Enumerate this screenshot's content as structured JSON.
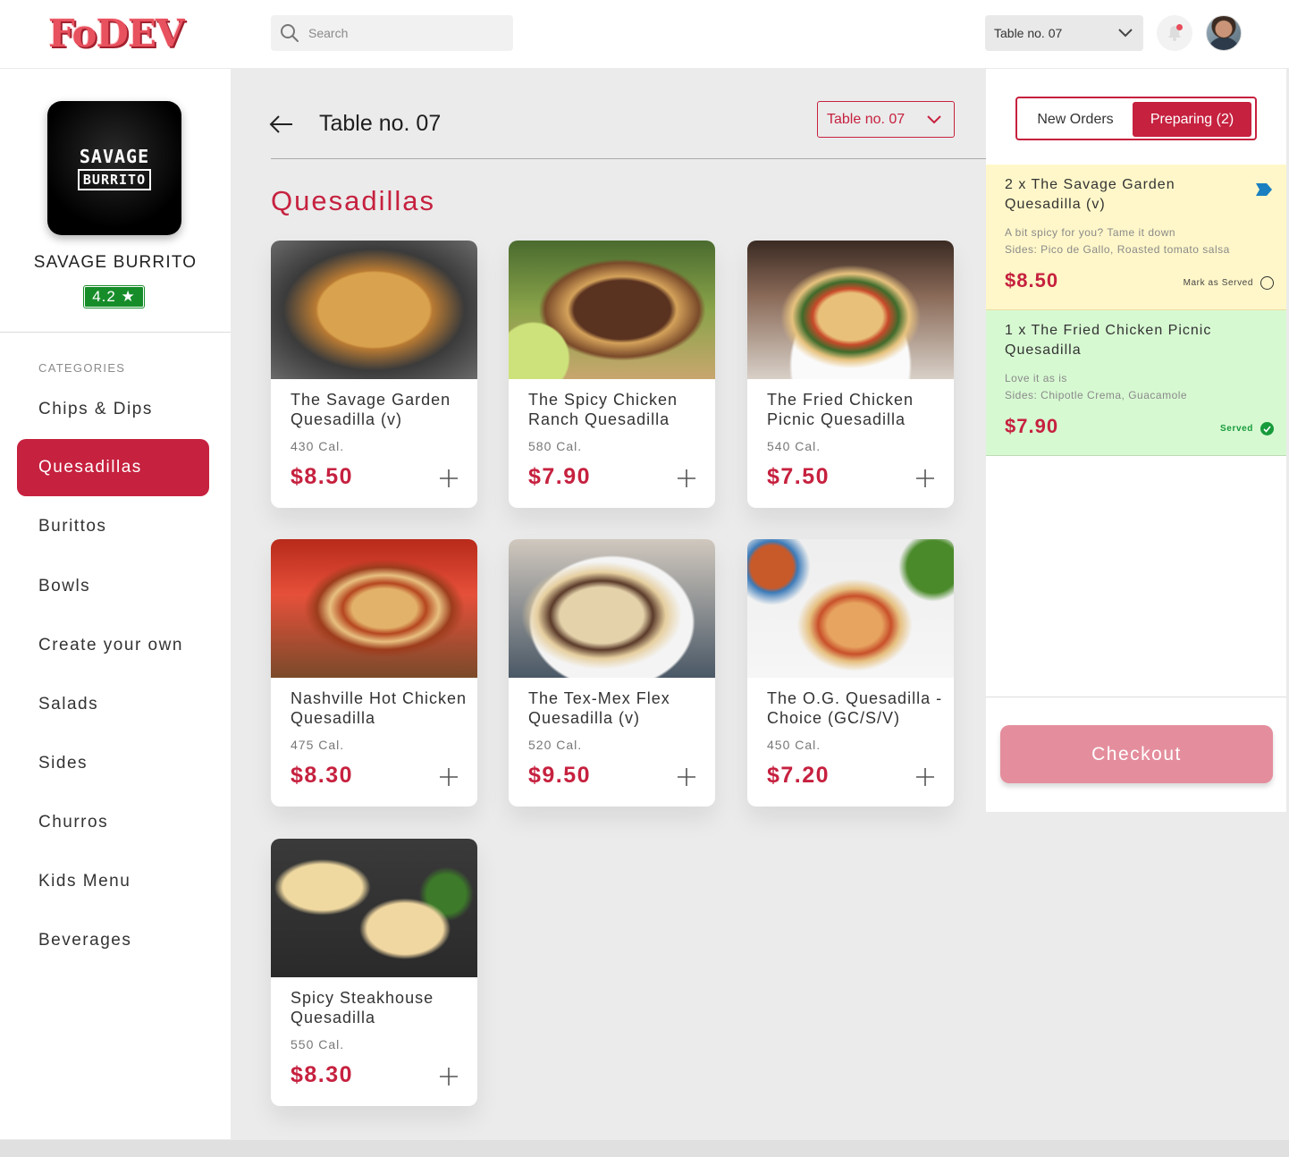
{
  "app": {
    "logo_text": "FoDEV"
  },
  "search": {
    "placeholder": "Search"
  },
  "top_table_select": {
    "value": "Table no. 07"
  },
  "restaurant": {
    "logo_line1": "SAVAGE",
    "logo_line2": "BURRITO",
    "name": "SAVAGE BURRITO",
    "rating": "4.2 ★"
  },
  "categories": {
    "header": "CATEGORIES",
    "items": [
      {
        "label": "Chips & Dips"
      },
      {
        "label": "Quesadillas"
      },
      {
        "label": "Burittos"
      },
      {
        "label": "Bowls"
      },
      {
        "label": "Create your own"
      },
      {
        "label": "Salads"
      },
      {
        "label": "Sides"
      },
      {
        "label": "Churros"
      },
      {
        "label": "Kids Menu"
      },
      {
        "label": "Beverages"
      }
    ],
    "active": "Quesadillas"
  },
  "main": {
    "title": "Table no. 07",
    "table_select": "Table no. 07",
    "section_title": "Quesadillas",
    "items": [
      {
        "name": "The Savage Garden Quesadilla (v)",
        "calories": "430 Cal.",
        "price": "$8.50"
      },
      {
        "name": "The Spicy Chicken Ranch Quesadilla",
        "calories": "580 Cal.",
        "price": "$7.90"
      },
      {
        "name": "The Fried Chicken Picnic Quesadilla",
        "calories": "540 Cal.",
        "price": "$7.50"
      },
      {
        "name": "Nashville Hot Chicken Quesadilla",
        "calories": "475 Cal.",
        "price": "$8.30"
      },
      {
        "name": "The Tex-Mex Flex Quesadilla (v)",
        "calories": "520 Cal.",
        "price": "$9.50"
      },
      {
        "name": "The O.G. Quesadilla - Choice (GC/S/V)",
        "calories": "450 Cal.",
        "price": "$7.20"
      },
      {
        "name": "Spicy Steakhouse Quesadilla",
        "calories": "550 Cal.",
        "price": "$8.30"
      }
    ]
  },
  "orders_panel": {
    "tabs": {
      "new_orders": "New Orders",
      "preparing": "Preparing (2)"
    },
    "orders": [
      {
        "title": "2 x The Savage Garden Quesadilla (v)",
        "note": "A bit spicy for you? Tame it down",
        "sides": "Sides: Pico de Gallo, Roasted tomato salsa",
        "price": "$8.50",
        "status": "Mark as Served"
      },
      {
        "title": "1 x The Fried Chicken Picnic Quesadilla",
        "note": "Love it as is",
        "sides": "Sides: Chipotle Crema, Guacamole",
        "price": "$7.90",
        "status": "Served"
      }
    ],
    "checkout_label": "Checkout"
  },
  "colors": {
    "accent": "#c6213f",
    "rating_green": "#178d2a",
    "order_yellow": "#fff7c9",
    "order_green": "#d7f9d2",
    "checkout_pink": "#e48e9d"
  },
  "icons": [
    "search-icon",
    "chevron-down-icon",
    "bell-icon",
    "back-arrow-icon",
    "plus-icon",
    "tag-icon",
    "radio-icon",
    "check-circle-icon"
  ]
}
